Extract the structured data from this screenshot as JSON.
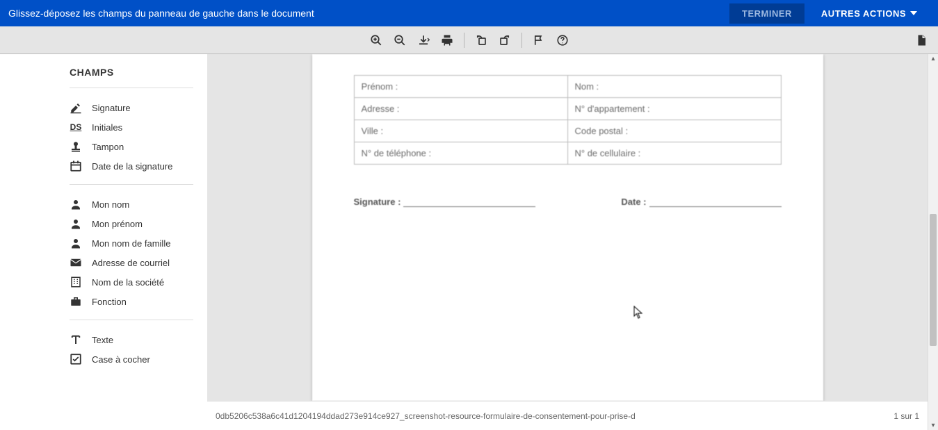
{
  "header": {
    "instruction": "Glissez-déposez les champs du panneau de gauche dans le document",
    "finish": "TERMINER",
    "actions": "AUTRES ACTIONS"
  },
  "sidebar": {
    "title": "CHAMPS",
    "group1": {
      "signature": "Signature",
      "initials": "Initiales",
      "stamp": "Tampon",
      "date_signed": "Date de la signature"
    },
    "group2": {
      "my_name": "Mon nom",
      "first_name": "Mon prénom",
      "last_name": "Mon nom de famille",
      "email": "Adresse de courriel",
      "company": "Nom de la société",
      "title": "Fonction"
    },
    "group3": {
      "text": "Texte",
      "checkbox": "Case à cocher"
    }
  },
  "doc": {
    "cells": {
      "prenom": "Prénom :",
      "nom": "Nom :",
      "adresse": "Adresse :",
      "appart": "N° d'appartement :",
      "ville": "Ville :",
      "postal": "Code postal :",
      "tel": "N° de téléphone :",
      "cell": "N° de cellulaire :"
    },
    "signature": "Signature :",
    "date": "Date :",
    "filename": "0db5206c538a6c41d1204194ddad273e914ce927_screenshot-resource-formulaire-de-consentement-pour-prise-d",
    "page_counter": "1 sur 1"
  }
}
